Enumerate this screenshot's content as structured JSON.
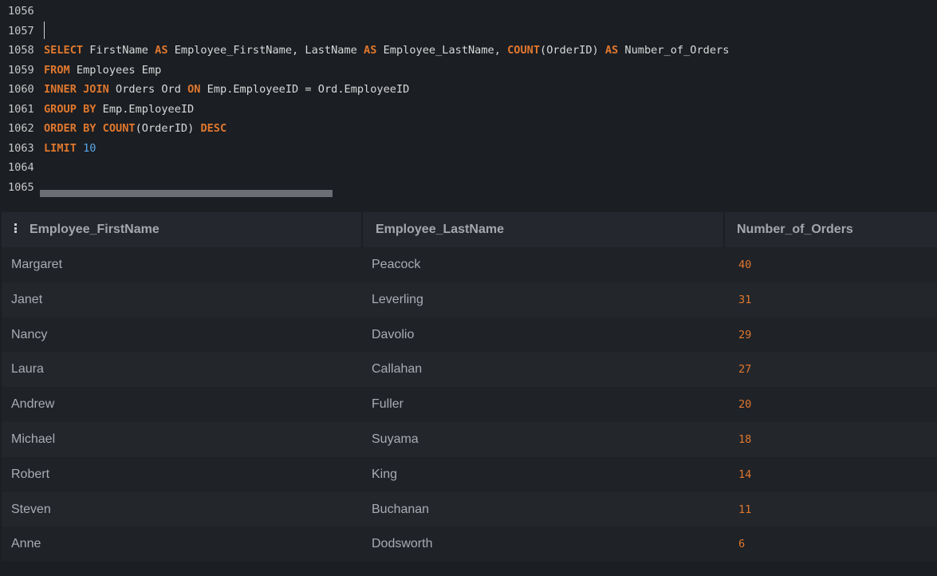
{
  "editor": {
    "lines": [
      {
        "num": "1056",
        "tokens": []
      },
      {
        "num": "1057",
        "tokens": []
      },
      {
        "num": "1058",
        "tokens": [
          {
            "t": "SELECT",
            "c": "kw"
          },
          {
            "t": " FirstName ",
            "c": ""
          },
          {
            "t": "AS",
            "c": "kw"
          },
          {
            "t": " Employee_FirstName, LastName ",
            "c": ""
          },
          {
            "t": "AS",
            "c": "kw"
          },
          {
            "t": " Employee_LastName, ",
            "c": ""
          },
          {
            "t": "COUNT",
            "c": "kw"
          },
          {
            "t": "(OrderID) ",
            "c": ""
          },
          {
            "t": "AS",
            "c": "kw"
          },
          {
            "t": " Number_of_Orders",
            "c": ""
          }
        ]
      },
      {
        "num": "1059",
        "tokens": [
          {
            "t": "FROM",
            "c": "kw"
          },
          {
            "t": " Employees Emp",
            "c": ""
          }
        ]
      },
      {
        "num": "1060",
        "tokens": [
          {
            "t": "INNER",
            "c": "kw"
          },
          {
            "t": " ",
            "c": ""
          },
          {
            "t": "JOIN",
            "c": "kw"
          },
          {
            "t": " Orders Ord ",
            "c": ""
          },
          {
            "t": "ON",
            "c": "kw"
          },
          {
            "t": " Emp.EmployeeID = Ord.EmployeeID",
            "c": ""
          }
        ]
      },
      {
        "num": "1061",
        "tokens": [
          {
            "t": "GROUP",
            "c": "kw"
          },
          {
            "t": " ",
            "c": ""
          },
          {
            "t": "BY",
            "c": "kw"
          },
          {
            "t": " Emp.EmployeeID",
            "c": ""
          }
        ]
      },
      {
        "num": "1062",
        "tokens": [
          {
            "t": "ORDER",
            "c": "kw"
          },
          {
            "t": " ",
            "c": ""
          },
          {
            "t": "BY",
            "c": "kw"
          },
          {
            "t": " ",
            "c": ""
          },
          {
            "t": "COUNT",
            "c": "kw"
          },
          {
            "t": "(OrderID) ",
            "c": ""
          },
          {
            "t": "DESC",
            "c": "kw"
          }
        ]
      },
      {
        "num": "1063",
        "tokens": [
          {
            "t": "LIMIT",
            "c": "kw"
          },
          {
            "t": " ",
            "c": ""
          },
          {
            "t": "10",
            "c": "num"
          }
        ]
      },
      {
        "num": "1064",
        "tokens": []
      },
      {
        "num": "1065",
        "tokens": []
      }
    ]
  },
  "results": {
    "columns": [
      "Employee_FirstName",
      "Employee_LastName",
      "Number_of_Orders"
    ],
    "rows": [
      [
        "Margaret",
        "Peacock",
        "40"
      ],
      [
        "Janet",
        "Leverling",
        "31"
      ],
      [
        "Nancy",
        "Davolio",
        "29"
      ],
      [
        "Laura",
        "Callahan",
        "27"
      ],
      [
        "Andrew",
        "Fuller",
        "20"
      ],
      [
        "Michael",
        "Suyama",
        "18"
      ],
      [
        "Robert",
        "King",
        "14"
      ],
      [
        "Steven",
        "Buchanan",
        "11"
      ],
      [
        "Anne",
        "Dodsworth",
        "6"
      ]
    ]
  },
  "colors": {
    "keyword": "#e0782e",
    "number": "#5aa6e6",
    "background": "#1b1e23"
  }
}
